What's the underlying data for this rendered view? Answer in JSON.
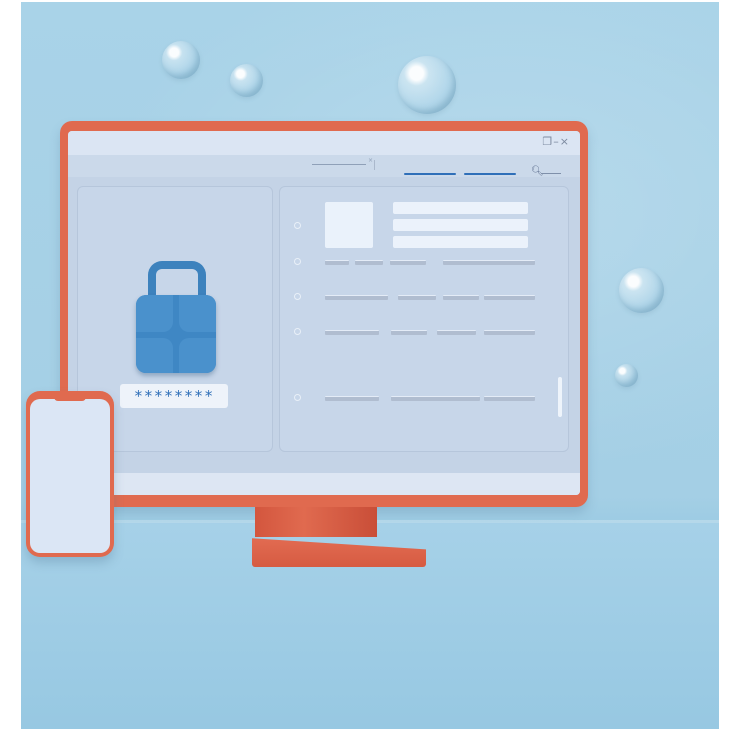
{
  "window_controls": "❐–×",
  "password_mask": "********",
  "icons": [
    "lock-icon",
    "search-icon",
    "restore-icon",
    "minimize-icon",
    "close-icon"
  ],
  "colors": {
    "monitor": "#e06a4f",
    "accent_blue": "#2f6fb8",
    "lock": "#3f87c4",
    "background": "#a9d3e8"
  }
}
